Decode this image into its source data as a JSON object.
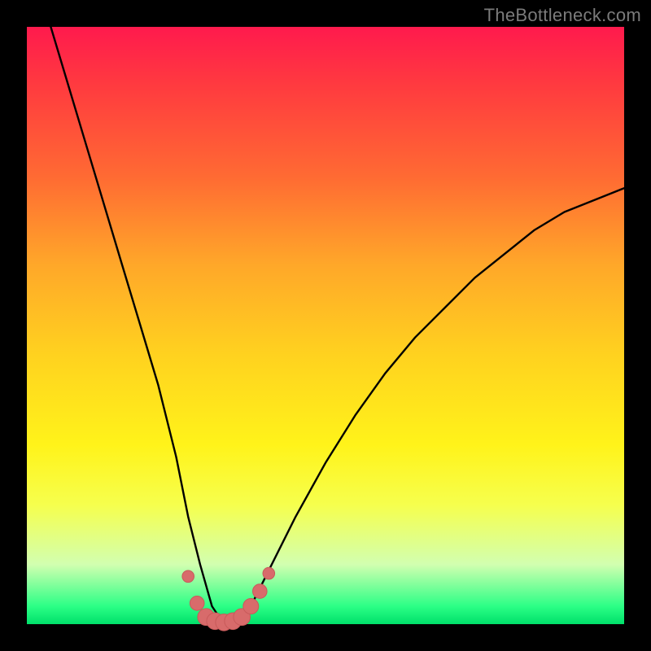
{
  "watermark": "TheBottleneck.com",
  "colors": {
    "frame_bg": "#000000",
    "watermark": "#7b7b7b",
    "curve": "#000000",
    "marker_fill": "#d86b6b",
    "marker_stroke": "#c85a5a",
    "gradient_stops": [
      {
        "pct": 0,
        "hex": "#ff1a4d"
      },
      {
        "pct": 10,
        "hex": "#ff3b3f"
      },
      {
        "pct": 25,
        "hex": "#ff6a33"
      },
      {
        "pct": 40,
        "hex": "#ffa829"
      },
      {
        "pct": 55,
        "hex": "#ffd21f"
      },
      {
        "pct": 70,
        "hex": "#fff31a"
      },
      {
        "pct": 80,
        "hex": "#f6ff4d"
      },
      {
        "pct": 90,
        "hex": "#d2ffb0"
      },
      {
        "pct": 97,
        "hex": "#2cff86"
      },
      {
        "pct": 100,
        "hex": "#00e06a"
      }
    ]
  },
  "chart_data": {
    "type": "line",
    "title": "",
    "xlabel": "",
    "ylabel": "",
    "xlim": [
      0,
      100
    ],
    "ylim": [
      0,
      100
    ],
    "comment": "V-shaped bottleneck curve on a heat gradient. Values estimated from pixels; y=0 is bottom (green), y=100 is top (red). Minimum of curve near x≈32, y≈0.",
    "series": [
      {
        "name": "bottleneck-curve",
        "x": [
          4,
          7,
          10,
          13,
          16,
          19,
          22,
          25,
          27,
          29,
          31,
          33,
          35,
          37,
          40,
          45,
          50,
          55,
          60,
          65,
          70,
          75,
          80,
          85,
          90,
          95,
          100
        ],
        "y": [
          100,
          90,
          80,
          70,
          60,
          50,
          40,
          28,
          18,
          10,
          3,
          0,
          0,
          2,
          8,
          18,
          27,
          35,
          42,
          48,
          53,
          58,
          62,
          66,
          69,
          71,
          73
        ]
      }
    ],
    "markers": {
      "name": "highlight-dots",
      "color": "#d86b6b",
      "points": [
        {
          "x": 27.0,
          "y": 8.0,
          "r": 1.0
        },
        {
          "x": 28.5,
          "y": 3.5,
          "r": 1.2
        },
        {
          "x": 30.0,
          "y": 1.2,
          "r": 1.4
        },
        {
          "x": 31.5,
          "y": 0.5,
          "r": 1.4
        },
        {
          "x": 33.0,
          "y": 0.3,
          "r": 1.4
        },
        {
          "x": 34.5,
          "y": 0.5,
          "r": 1.4
        },
        {
          "x": 36.0,
          "y": 1.2,
          "r": 1.4
        },
        {
          "x": 37.5,
          "y": 3.0,
          "r": 1.3
        },
        {
          "x": 39.0,
          "y": 5.5,
          "r": 1.2
        },
        {
          "x": 40.5,
          "y": 8.5,
          "r": 1.0
        }
      ]
    }
  }
}
